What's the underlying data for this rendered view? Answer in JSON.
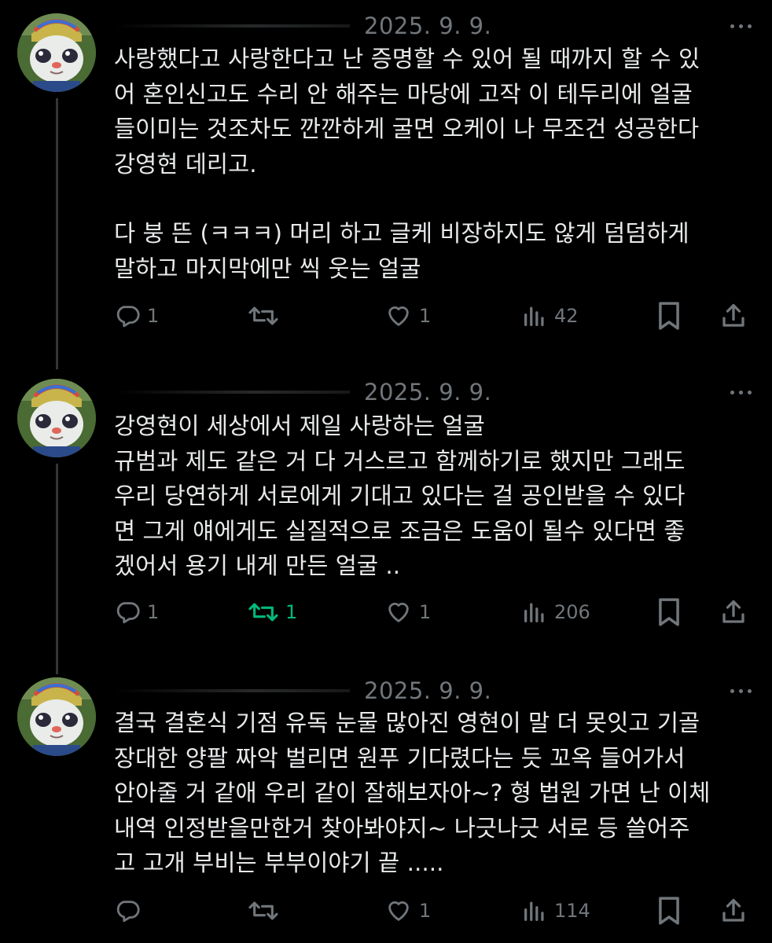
{
  "tweets": [
    {
      "date": "2025. 9. 9.",
      "lines": [
        "사랑했다고 사랑한다고 난 증명할 수 있어 될 때까지 할 수 있",
        "어 혼인신고도 수리 안 해주는 마당에 고작 이 테두리에 얼굴",
        "들이미는 것조차도 깐깐하게 굴면 오케이 나 무조건 성공한다",
        "강영현 데리고.",
        "",
        "다 붕 뜬 (ㅋㅋㅋ) 머리 하고 글케 비장하지도 않게 덤덤하게",
        "말하고 마지막에만 씩 웃는 얼굴"
      ],
      "actions": {
        "reply_count": "1",
        "retweet_count": "",
        "like_count": "1",
        "view_count": "42"
      }
    },
    {
      "date": "2025. 9. 9.",
      "lines": [
        "강영현이 세상에서 제일 사랑하는 얼굴",
        "규범과 제도 같은 거 다 거스르고 함께하기로 했지만 그래도",
        "우리 당연하게 서로에게 기대고 있다는 걸 공인받을 수 있다",
        "면 그게 얘에게도 실질적으로 조금은 도움이 될수 있다면 좋",
        "겠어서 용기 내게 만든 얼굴 .."
      ],
      "actions": {
        "reply_count": "1",
        "retweet_count": "1",
        "like_count": "1",
        "view_count": "206"
      }
    },
    {
      "date": "2025. 9. 9.",
      "lines": [
        "결국 결혼식 기점 유독 눈물 많아진 영현이 말 더 못잇고 기골",
        "장대한 양팔 짜악 벌리면 원푸 기다렸다는 듯 꼬옥 들어가서",
        "안아줄 거 같애 우리 같이 잘해보자아~? 형 법원 가면 난 이체",
        "내역 인정받을만한거 찾아봐야지~ 나긋나긋 서로 등 쓸어주",
        "고 고개 부비는 부부이야기 끝 ....."
      ],
      "actions": {
        "reply_count": "",
        "retweet_count": "",
        "like_count": "1",
        "view_count": "114"
      }
    }
  ],
  "icons": {
    "reply": "speech-bubble-icon",
    "retweet": "retweet-arrows-icon",
    "like": "heart-icon",
    "views": "bar-chart-icon",
    "bookmark": "bookmark-icon",
    "share": "share-upload-icon",
    "more": "ellipsis-icon"
  },
  "colors": {
    "background": "#000000",
    "text": "#e7e9ea",
    "muted": "#71767b",
    "retweet_active": "#00ba7c",
    "thread_line": "#333639"
  }
}
